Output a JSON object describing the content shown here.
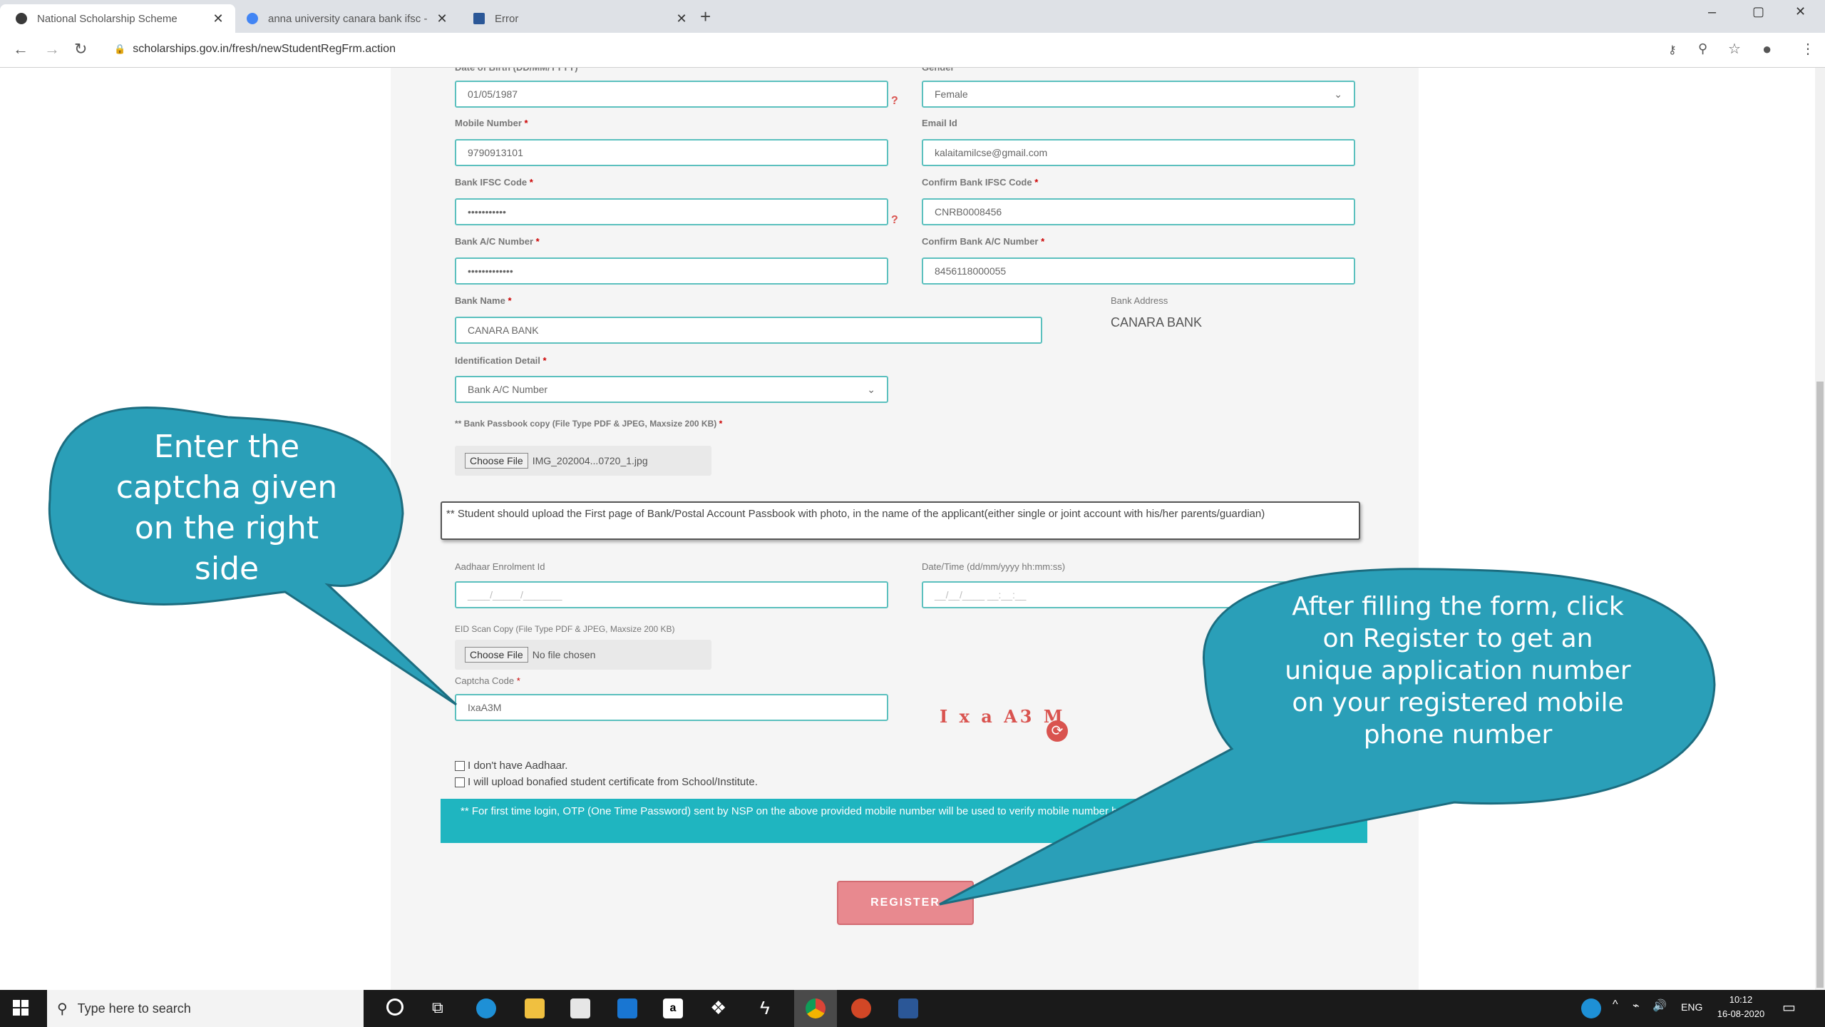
{
  "browser": {
    "tabs": [
      {
        "title": "National Scholarship Scheme",
        "active": true
      },
      {
        "title": "anna university canara bank ifsc -",
        "active": false
      },
      {
        "title": "Error",
        "active": false
      }
    ],
    "url": "scholarships.gov.in/fresh/newStudentRegFrm.action",
    "window_controls": [
      "–",
      "▢",
      "✕"
    ]
  },
  "form": {
    "dob_value": "01/05/1987",
    "gender_value": "Female",
    "mobile_label": "Mobile Number",
    "mobile_value": "9790913101",
    "email_label": "Email Id",
    "email_value": "kalaitamilcse@gmail.com",
    "ifsc_label": "Bank IFSC Code",
    "ifsc_value": "•••••••••••",
    "confirm_ifsc_label": "Confirm Bank IFSC Code",
    "confirm_ifsc_value": "CNRB0008456",
    "acno_label": "Bank A/C Number",
    "acno_value": "•••••••••••••",
    "confirm_acno_label": "Confirm Bank A/C Number",
    "confirm_acno_value": "8456118000055",
    "bank_name_label": "Bank Name",
    "bank_name_value": "CANARA BANK",
    "bank_address_label": "Bank Address",
    "bank_address_value": "CANARA BANK",
    "id_detail_label": "Identification Detail",
    "id_detail_value": "Bank A/C Number",
    "passbook_label": "** Bank Passbook copy (File Type PDF & JPEG, Maxsize 200 KB)",
    "choose_file": "Choose File",
    "passbook_file": "IMG_202004...0720_1.jpg",
    "passbook_note": "** Student should upload the First page of Bank/Postal Account Passbook with photo, in the name of the applicant(either single or joint account with his/her parents/guardian)",
    "aadhaar_enrol_label": "Aadhaar Enrolment Id",
    "aadhaar_enrol_placeholder": "____/_____/_______",
    "datetime_label": "Date/Time (dd/mm/yyyy hh:mm:ss)",
    "datetime_placeholder": "__/__/____ __:__:__",
    "eid_label": "EID Scan Copy (File Type PDF & JPEG, Maxsize 200 KB)",
    "eid_file": "No file chosen",
    "captcha_label": "Captcha Code",
    "captcha_value": "IxaA3M",
    "captcha_image_text": "I x a A3 M",
    "no_aadhaar": "I don't have Aadhaar.",
    "bonafide": "I will upload bonafied student certificate from School/Institute.",
    "otp_note": "** For first time login, OTP (One Time Password) sent by NSP on the above provided mobile number will be used to verify mobile number before registering.",
    "register_label": "REGISTER"
  },
  "callouts": {
    "left": "Enter the captcha given on the right side",
    "right": "After filling the form, click on Register to get an unique application number on your registered mobile phone number"
  },
  "taskbar": {
    "search_placeholder": "Type here to search",
    "language": "ENG",
    "time": "10:12",
    "date": "16-08-2020"
  },
  "colors": {
    "accent": "#5bc0be",
    "callout_fill": "#2a9fb8",
    "register": "#e8898f",
    "otp_bar": "#1fb5c0"
  }
}
